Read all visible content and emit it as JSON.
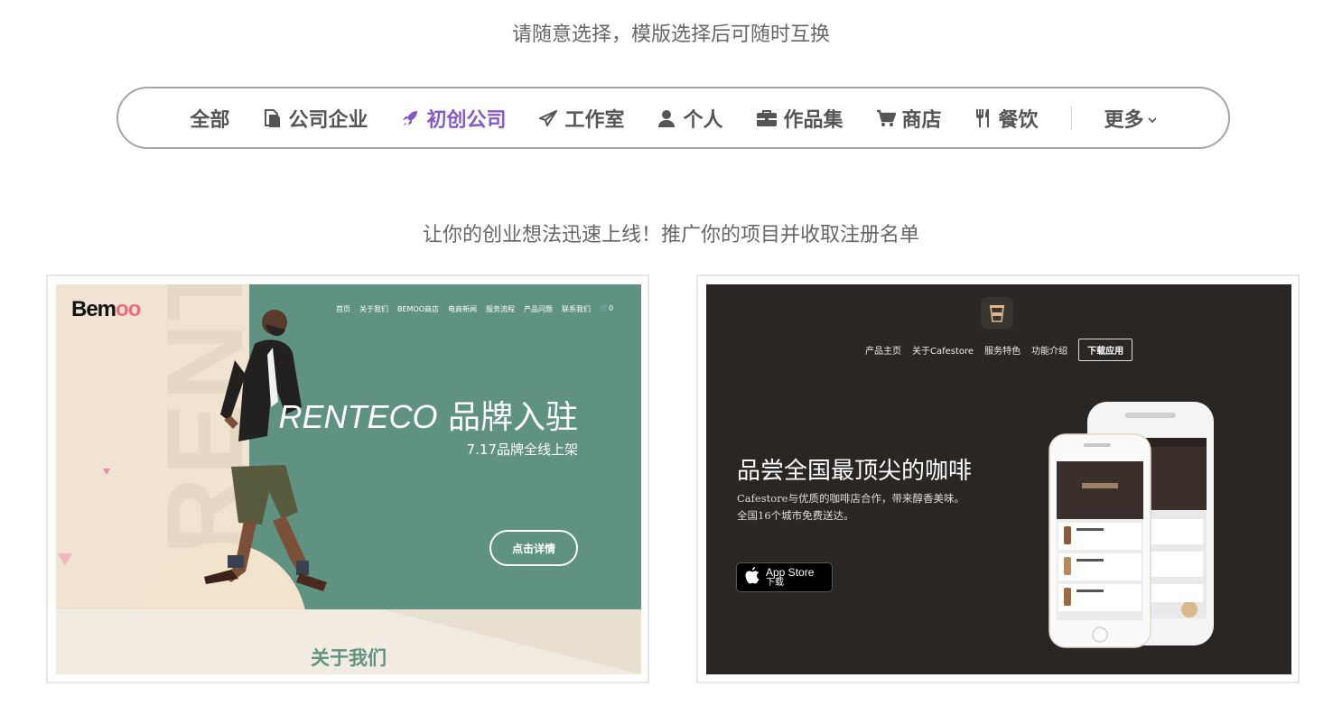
{
  "intro_text": "请随意选择，模版选择后可随时互换",
  "categories": [
    {
      "label": "全部",
      "icon": "none",
      "active": false
    },
    {
      "label": "公司企业",
      "icon": "document-icon",
      "active": false
    },
    {
      "label": "初创公司",
      "icon": "rocket-icon",
      "active": true
    },
    {
      "label": "工作室",
      "icon": "paper-plane-icon",
      "active": false
    },
    {
      "label": "个人",
      "icon": "user-icon",
      "active": false
    },
    {
      "label": "作品集",
      "icon": "briefcase-icon",
      "active": false
    },
    {
      "label": "商店",
      "icon": "cart-icon",
      "active": false
    },
    {
      "label": "餐饮",
      "icon": "utensils-icon",
      "active": false
    }
  ],
  "more_label": "更多",
  "section_subtitle": "让你的创业想法迅速上线！推广你的项目并收取注册名单",
  "colors": {
    "accent": "#8559c9",
    "text": "#555555",
    "green": "#5f9280",
    "dark": "#2a2624"
  },
  "template_a": {
    "logo_prefix": "Bem",
    "logo_suffix": "oo",
    "nav": [
      "首页",
      "关于我们",
      "BEMOO商店",
      "电商新闻",
      "服务流程",
      "产品问题",
      "联系我们",
      "0"
    ],
    "vertical_word": "RENTECO",
    "headline_brand": "RENTECO",
    "headline_rest": " 品牌入驻",
    "date_line": "7.17品牌全线上架",
    "cta": "点击详情",
    "about": "关于我们"
  },
  "template_b": {
    "nav": [
      "产品主页",
      "关于Cafestore",
      "服务特色",
      "功能介绍"
    ],
    "download": "下载应用",
    "title": "品尝全国最顶尖的咖啡",
    "desc_line1": "Cafestore与优质的咖啡店合作，带来醇香美味。",
    "desc_line2": "全国16个城市免费送达。",
    "appstore_line1": "App Store",
    "appstore_line2": "下载"
  }
}
